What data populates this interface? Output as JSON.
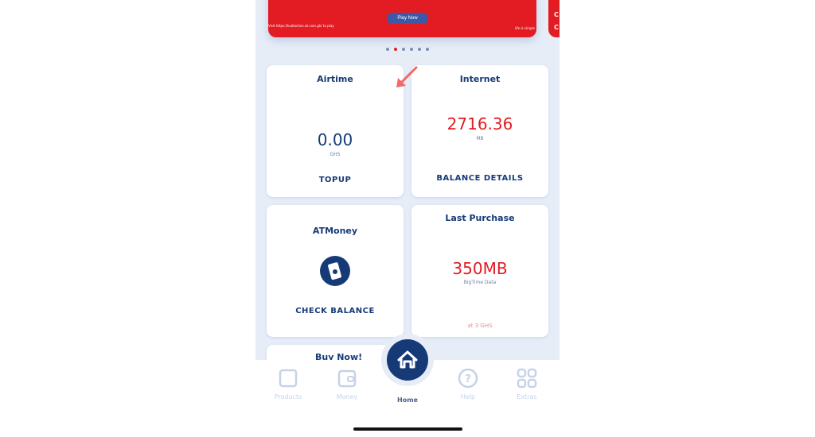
{
  "banner": {
    "play_label": "Play Now",
    "visit_text": "Visit https://kudiaction.at.com.gh/ to play",
    "life_text": "life is simple",
    "next_banner_text": "C\nC",
    "dots": 6,
    "active_dot": 2
  },
  "cards": {
    "airtime": {
      "title": "Airtime",
      "value": "0.00",
      "unit": "GHS",
      "action": "TOPUP"
    },
    "internet": {
      "title": "Internet",
      "value": "2716.36",
      "unit": "MB",
      "action": "BALANCE DETAILS"
    },
    "atmoney": {
      "title": "ATMoney",
      "action": "CHECK BALANCE"
    },
    "last_purchase": {
      "title": "Last Purchase",
      "value": "350MB",
      "subtitle": "BigTime Data",
      "price": "at 3 GHS"
    },
    "buy_now": {
      "title": "Buy Now!"
    }
  },
  "nav": {
    "items": [
      {
        "label": "Products",
        "icon": "box-icon"
      },
      {
        "label": "Money",
        "icon": "wallet-icon"
      },
      {
        "label": "Home",
        "icon": "home-icon",
        "active": true
      },
      {
        "label": "Help",
        "icon": "help-icon"
      },
      {
        "label": "Extras",
        "icon": "grid-icon"
      }
    ]
  },
  "colors": {
    "brand": "#163a78",
    "accent": "#e31b23",
    "annotation_arrow": "#f06a6a"
  }
}
